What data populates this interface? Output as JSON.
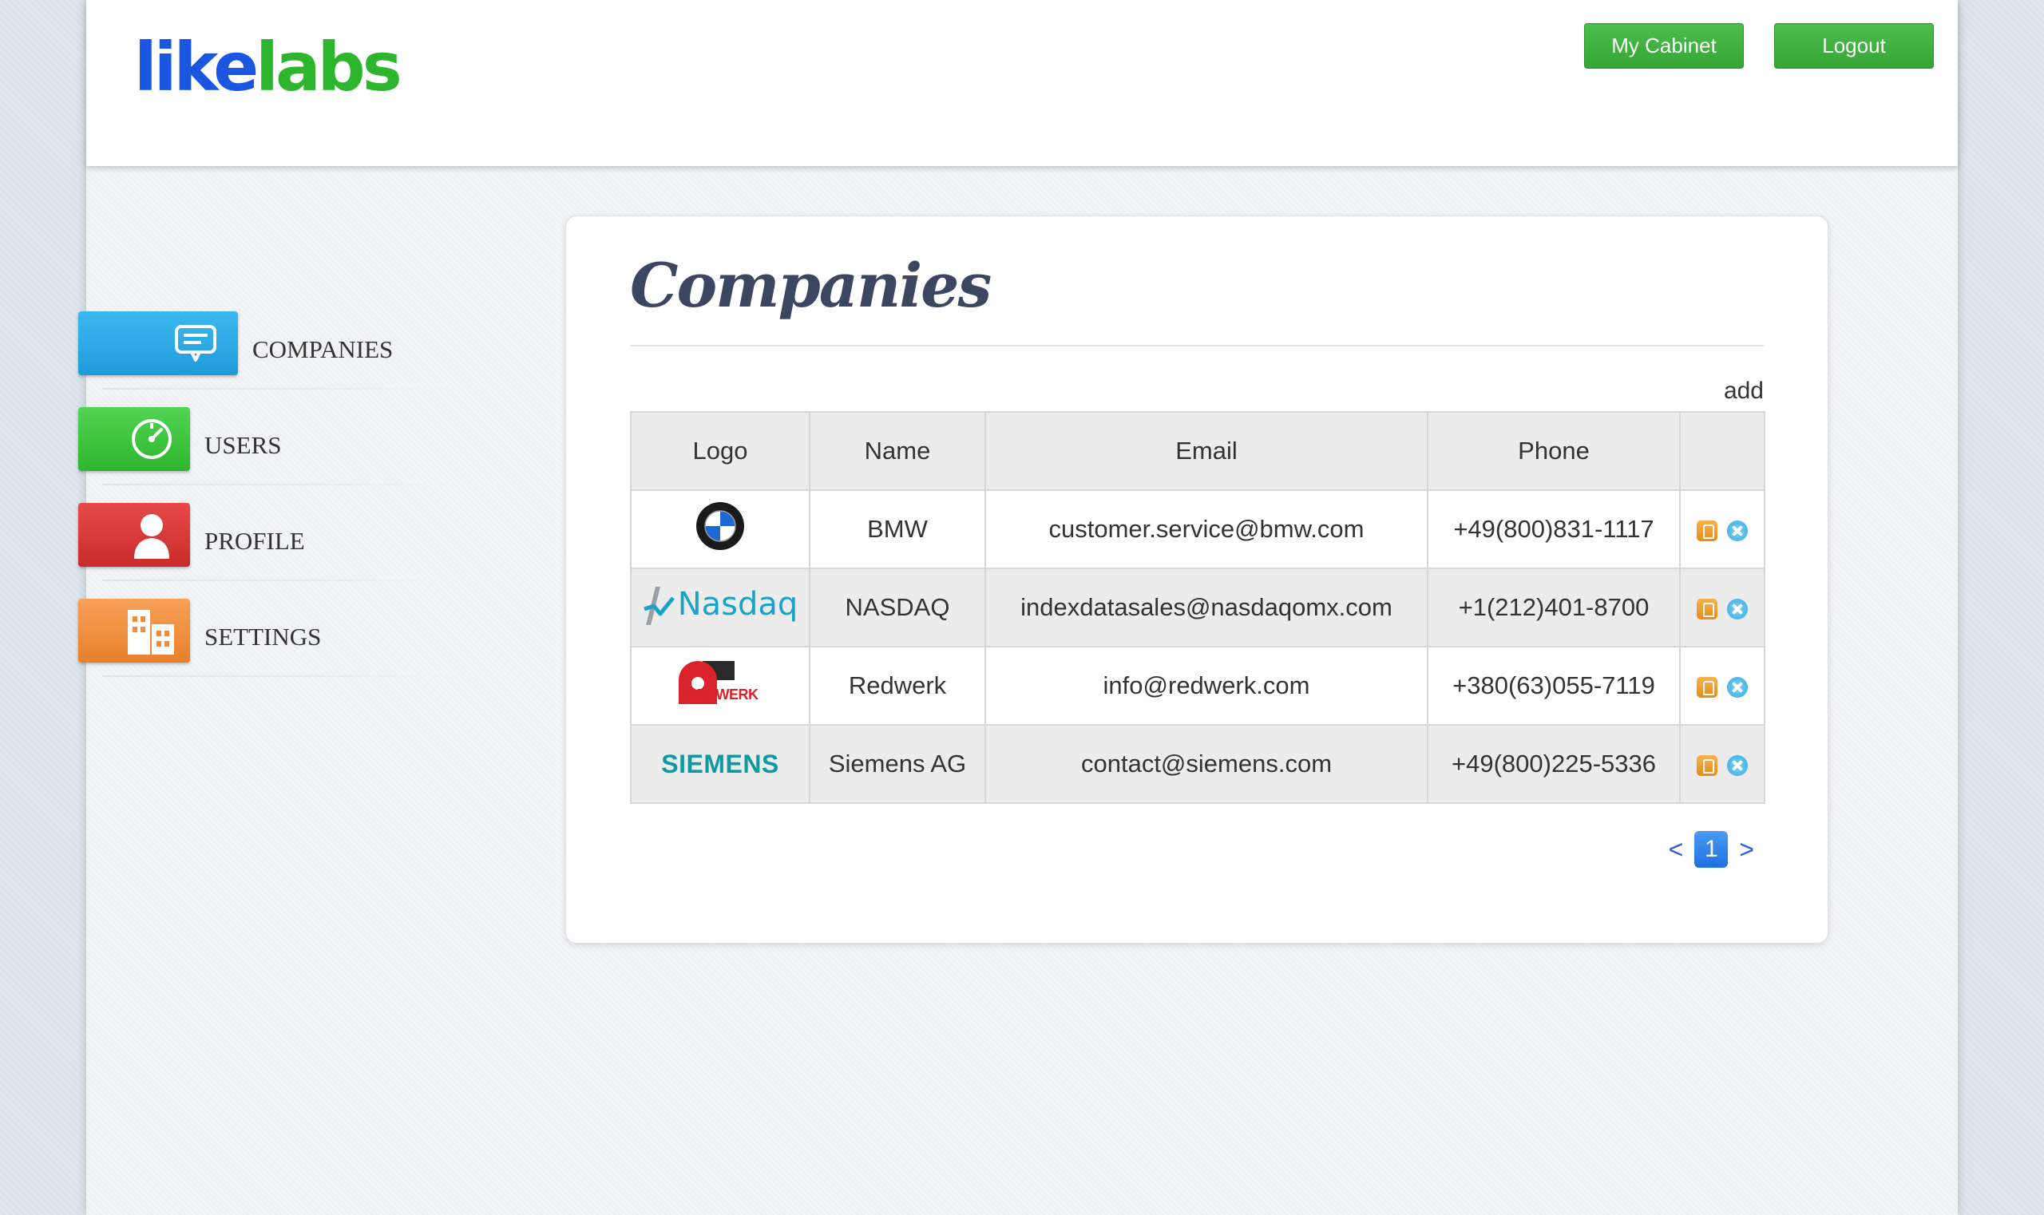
{
  "header": {
    "logo": {
      "part1": "like",
      "part2": "labs"
    },
    "buttons": {
      "my_cabinet": "My Cabinet",
      "logout": "Logout"
    }
  },
  "sidebar": {
    "items": [
      {
        "label": "COMPANIES",
        "icon": "chat-bubble-icon",
        "color": "#2aa7e3"
      },
      {
        "label": "USERS",
        "icon": "speedometer-icon",
        "color": "#3cc43c"
      },
      {
        "label": "PROFILE",
        "icon": "person-icon",
        "color": "#d93434"
      },
      {
        "label": "SETTINGS",
        "icon": "building-icon",
        "color": "#f08c3a"
      }
    ]
  },
  "main": {
    "title": "Companies",
    "add_label": "add",
    "table": {
      "columns": [
        "Logo",
        "Name",
        "Email",
        "Phone",
        ""
      ],
      "rows": [
        {
          "logo": "BMW",
          "name": "BMW",
          "email": "customer.service@bmw.com",
          "phone": "+49(800)831-1117"
        },
        {
          "logo": "Nasdaq",
          "name": "NASDAQ",
          "email": "indexdatasales@nasdaqomx.com",
          "phone": "+1(212)401-8700"
        },
        {
          "logo": "REDWERK",
          "name": "Redwerk",
          "email": "info@redwerk.com",
          "phone": "+380(63)055-7119"
        },
        {
          "logo": "SIEMENS",
          "name": "Siemens AG",
          "email": "contact@siemens.com",
          "phone": "+49(800)225-5336"
        }
      ]
    },
    "pagination": {
      "prev": "<",
      "current": "1",
      "next": ">"
    }
  }
}
